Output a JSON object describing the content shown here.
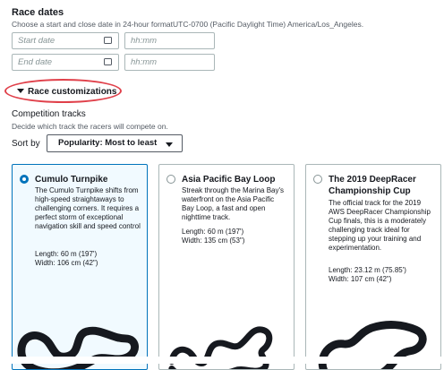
{
  "race_dates": {
    "title": "Race dates",
    "description": "Choose a start and close date in 24-hour formatUTC-0700 (Pacific Daylight Time) America/Los_Angeles.",
    "start_date_placeholder": "Start date",
    "start_time_placeholder": "hh:mm",
    "end_date_placeholder": "End date",
    "end_time_placeholder": "hh:mm"
  },
  "customizations": {
    "toggle_label": "Race customizations"
  },
  "competition_tracks": {
    "title": "Competition tracks",
    "description": "Decide which track the racers will compete on.",
    "sort_label": "Sort by",
    "sort_value": "Popularity: Most to least"
  },
  "tracks": [
    {
      "title": "Cumulo Turnpike",
      "description": "The Cumulo Turnpike shifts from high-speed straightaways to challenging corners. It requires a perfect storm of exceptional navigation skill and speed control",
      "length": "Length: 60 m (197')",
      "width": "Width: 106 cm (42\")",
      "selected": true
    },
    {
      "title": "Asia Pacific Bay Loop",
      "description": "Streak through the Marina Bay's waterfront on the Asia Pacific Bay Loop, a fast and open nighttime track.",
      "length": "Length: 60 m (197')",
      "width": "Width: 135 cm (53\")",
      "selected": false
    },
    {
      "title": "The 2019 DeepRacer Championship Cup",
      "description": "The official track for the 2019 AWS DeepRacer Championship Cup finals, this is a moderately challenging track ideal for stepping up your training and experimentation.",
      "length": "Length: 23.12 m (75.85')",
      "width": "Width: 107 cm (42\")",
      "selected": false
    }
  ],
  "colors": {
    "selected_border": "#0073bb",
    "highlight_ring": "#e0404a",
    "track": "#16191f"
  }
}
